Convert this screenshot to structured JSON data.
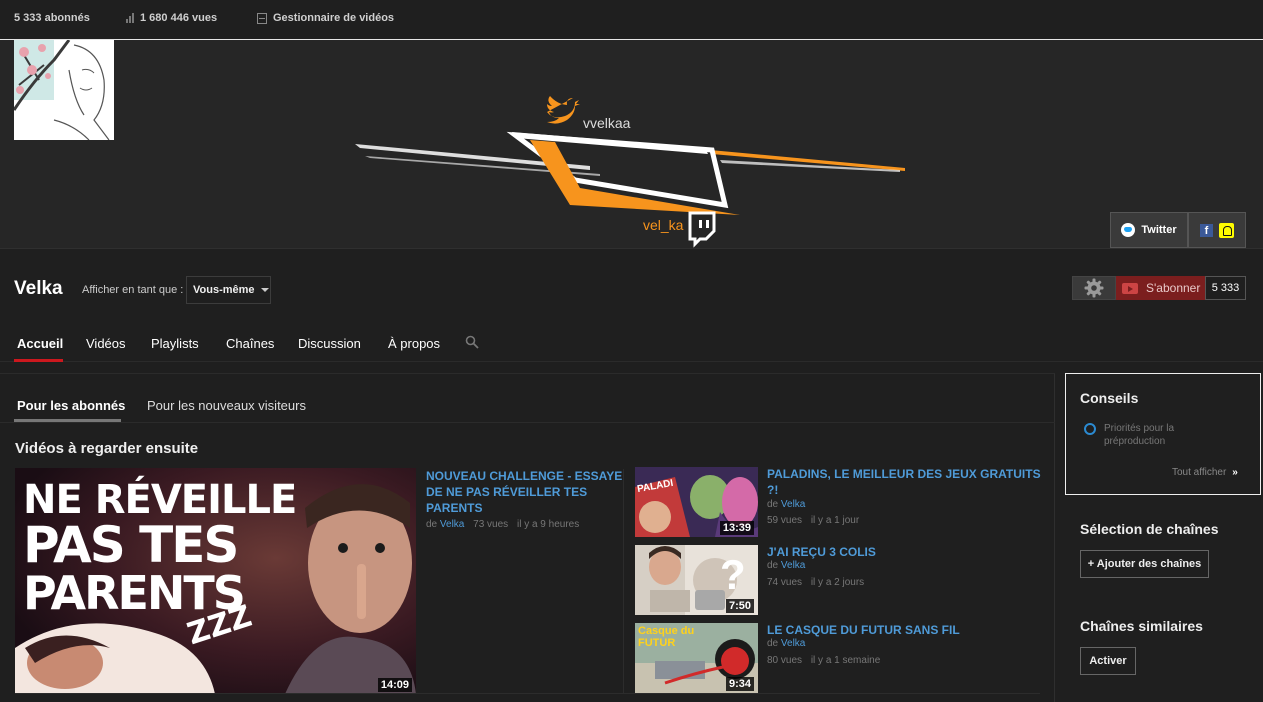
{
  "topbar": {
    "subscribers": "5 333 abonnés",
    "views": "1 680 446 vues",
    "video_manager": "Gestionnaire de vidéos"
  },
  "banner": {
    "twitter_handle": "vvelkaa",
    "twitch_handle": "vel_ka",
    "links": {
      "twitter_label": "Twitter",
      "icons": [
        "facebook-icon",
        "snapchat-icon"
      ]
    },
    "colors": {
      "accent": "#f7941d",
      "twitter": "#1da1f2"
    }
  },
  "channel": {
    "name": "Velka",
    "view_as_label": "Afficher en tant que :",
    "view_as_value": "Vous-même",
    "subscribe_label": "S'abonner",
    "subscribe_count": "5 333"
  },
  "tabs": [
    "Accueil",
    "Vidéos",
    "Playlists",
    "Chaînes",
    "Discussion",
    "À propos"
  ],
  "subtabs": [
    "Pour les abonnés",
    "Pour les nouveaux visiteurs"
  ],
  "section": {
    "title": "Vidéos à regarder ensuite"
  },
  "featured": {
    "thumb_text": [
      "NE RÉVEILLE",
      "PAS TES",
      "PARENTS"
    ],
    "thumb_zzz": "ZZZ",
    "duration": "14:09",
    "title": "NOUVEAU CHALLENGE - ESSAYE DE NE PAS RÉVEILLER TES PARENTS",
    "by": "de",
    "channel": "Velka",
    "views": "73 vues",
    "age": "il y a 9 heures"
  },
  "videos": [
    {
      "title": "PALADINS, LE MEILLEUR DES JEUX GRATUITS ?!",
      "duration": "13:39",
      "by": "de",
      "channel": "Velka",
      "views": "59 vues",
      "age": "il y a 1 jour",
      "thumb_text": "PALADI"
    },
    {
      "title": "J'AI REÇU 3 COLIS",
      "duration": "7:50",
      "by": "de",
      "channel": "Velka",
      "views": "74 vues",
      "age": "il y a 2 jours",
      "thumb_text": "?"
    },
    {
      "title": "LE CASQUE DU FUTUR SANS FIL",
      "duration": "9:34",
      "by": "de",
      "channel": "Velka",
      "views": "80 vues",
      "age": "il y a 1 semaine",
      "thumb_text": "Casque du FUTUR"
    }
  ],
  "sidebar": {
    "tips_title": "Conseils",
    "tips_item": "Priorités pour la préproduction",
    "tips_all": "Tout afficher",
    "tips_all_arrow": "»",
    "channel_selection_title": "Sélection de chaînes",
    "add_channels": "+ Ajouter des chaînes",
    "similar_title": "Chaînes similaires",
    "activate": "Activer"
  }
}
